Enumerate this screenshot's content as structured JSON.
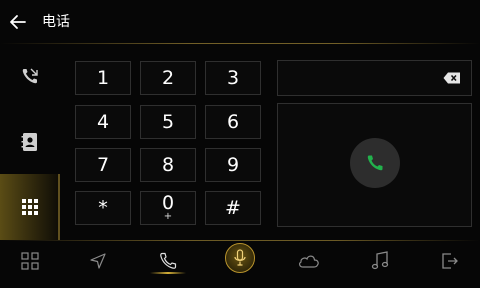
{
  "header": {
    "title": "电话"
  },
  "keypad": {
    "keys": [
      {
        "main": "1",
        "sub": ""
      },
      {
        "main": "2",
        "sub": ""
      },
      {
        "main": "3",
        "sub": ""
      },
      {
        "main": "4",
        "sub": ""
      },
      {
        "main": "5",
        "sub": ""
      },
      {
        "main": "6",
        "sub": ""
      },
      {
        "main": "7",
        "sub": ""
      },
      {
        "main": "8",
        "sub": ""
      },
      {
        "main": "9",
        "sub": ""
      },
      {
        "main": "*",
        "sub": ""
      },
      {
        "main": "0",
        "sub": "+"
      },
      {
        "main": "#",
        "sub": ""
      }
    ]
  },
  "dial_field": {
    "value": ""
  },
  "colors": {
    "accent_gold": "#d4af37",
    "call_green": "#22b14c",
    "icon_gray": "#8a8a8a"
  },
  "icons": {
    "back": "back-arrow-icon",
    "sidebar": [
      "call-log-icon",
      "contacts-icon",
      "dialpad-icon"
    ],
    "dock": [
      "apps-grid-icon",
      "navigation-icon",
      "phone-icon",
      "microphone-icon",
      "weather-cloud-icon",
      "music-note-icon",
      "exit-icon"
    ]
  }
}
